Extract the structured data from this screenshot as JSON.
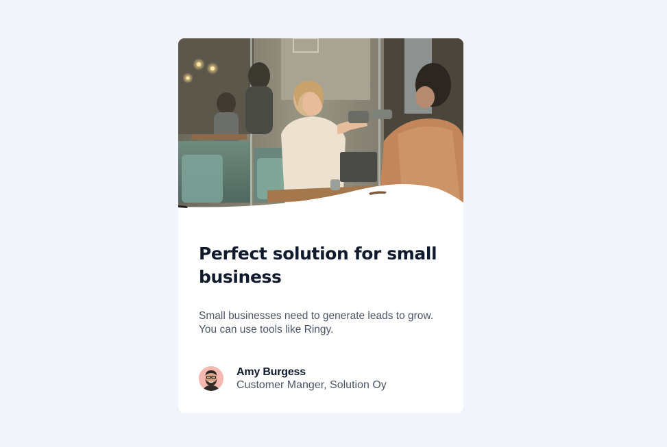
{
  "card": {
    "title": "Perfect solution for small business",
    "description": "Small businesses need to generate leads to grow. You can use tools like Ringy."
  },
  "author": {
    "name": "Amy Burgess",
    "role": "Customer Manger, Solution Oy"
  },
  "colors": {
    "page_background": "#f1f4f9",
    "card_background": "#ffffff",
    "title_text": "#101a2c",
    "body_text": "#4c5566",
    "avatar_background": "#f6b9b2"
  },
  "icons": {
    "hero": "cafe-photo",
    "avatar": "bearded-man-avatar"
  }
}
